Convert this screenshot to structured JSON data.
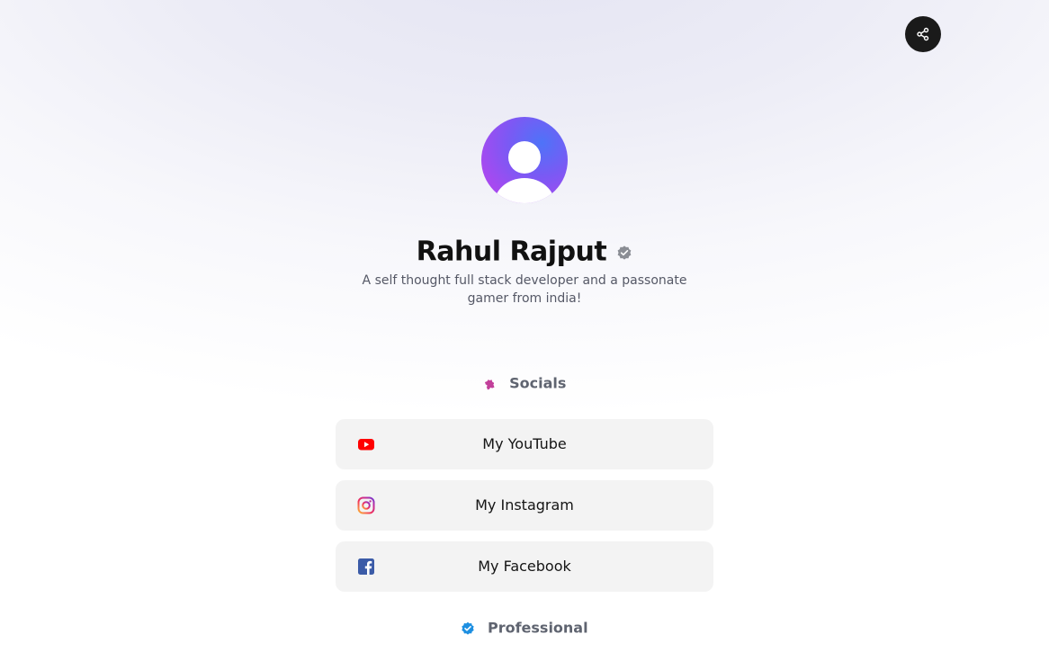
{
  "header": {
    "share_icon": "share-icon"
  },
  "profile": {
    "avatar_icon": "user-avatar-icon",
    "name": "Rahul Rajput",
    "verified_icon": "verified-badge-icon",
    "bio": "A self thought full stack developer and a passonate gamer from india!"
  },
  "sections": {
    "socials": {
      "title": "Socials",
      "icon": "puzzle-icon",
      "links": [
        {
          "label": "My YouTube",
          "icon": "youtube-icon",
          "color": "#ff0000"
        },
        {
          "label": "My Instagram",
          "icon": "instagram-icon",
          "color": "#d6249f"
        },
        {
          "label": "My Facebook",
          "icon": "facebook-icon",
          "color": "#3b5998"
        }
      ]
    },
    "professional": {
      "title": "Professional",
      "icon": "verified-check-icon"
    }
  },
  "colors": {
    "share_button_bg": "#1a1a1a",
    "link_button_bg": "#f3f3f3",
    "section_title": "#5f6470",
    "verified_blue": "#1d8fe1"
  }
}
